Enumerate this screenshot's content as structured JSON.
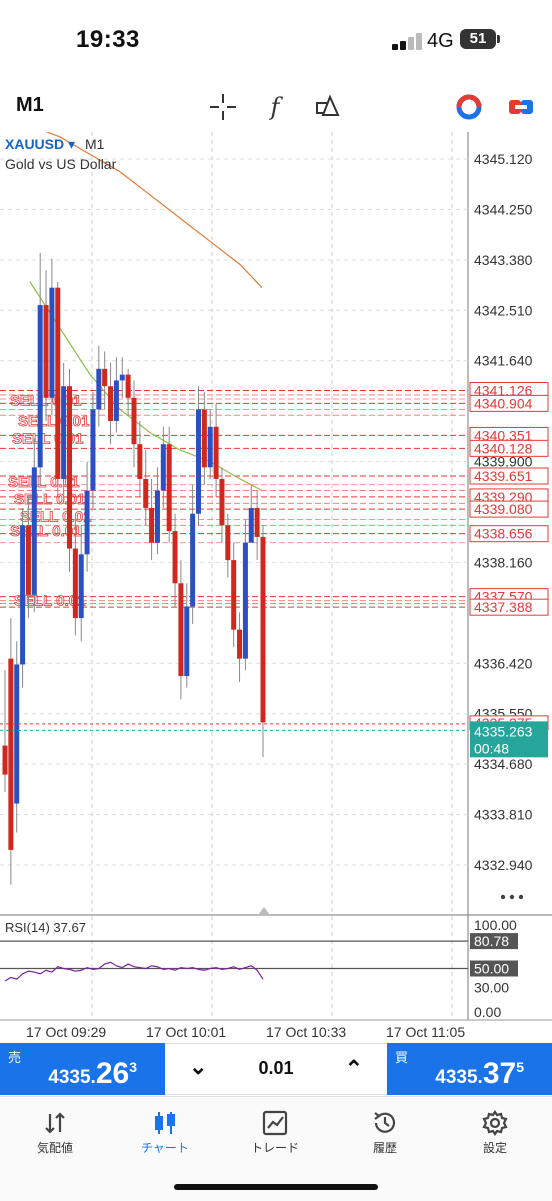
{
  "status_bar": {
    "time": "19:33",
    "network": "4G",
    "battery": "51"
  },
  "toolbar": {
    "timeframe": "M1",
    "icons": [
      "crosshair-icon",
      "function-icon",
      "objects-icon",
      "trade-settings-icon",
      "chart-switch-icon"
    ]
  },
  "chart": {
    "symbol": "XAUUSD",
    "symbol_arrow": "▾",
    "timeframe": "M1",
    "description": "Gold vs US Dollar",
    "price_scale": [
      "4345.120",
      "4344.250",
      "4343.380",
      "4342.510",
      "4341.640",
      "4339.900",
      "4338.160",
      "4336.420",
      "4335.550",
      "4334.680",
      "4333.810",
      "4332.940"
    ],
    "order_labels": [
      "4341.126",
      "4340.904",
      "4340.351",
      "4340.128",
      "4339.651",
      "4339.290",
      "4339.080",
      "4338.656",
      "4337.570",
      "4337.388"
    ],
    "ask_tag": "4335.375",
    "bid_tag": "4335.263",
    "countdown": "00:48",
    "sell_text": "SELL 0.01",
    "more_icon": "more-dots-icon",
    "time_labels": [
      "17 Oct 09:29",
      "17 Oct 10:01",
      "17 Oct 10:33",
      "17 Oct 11:05"
    ],
    "rsi": {
      "label": "RSI(14) 37.67",
      "levels": [
        "100.00",
        "80.78",
        "50.00",
        "30.00",
        "0.00"
      ]
    },
    "colors": {
      "bull": "#2c4fc4",
      "bear": "#d0281f",
      "ma_orange": "#e07b39",
      "ma_green": "#8bc34a",
      "rsi": "#7b1fa2",
      "bid": "#26a69a",
      "sell_lines": "#e53935"
    }
  },
  "chart_data": {
    "type": "candlestick",
    "symbol": "XAUUSD",
    "timeframe": "M1",
    "x": [
      "17 Oct 09:29",
      "17 Oct 10:01",
      "17 Oct 10:33",
      "17 Oct 11:05"
    ],
    "ylim": [
      4332.5,
      4345.5
    ],
    "close": [
      4334.5,
      4333.2,
      4336.4,
      4338.8,
      4337.6,
      4339.8,
      4342.6,
      4341.0,
      4342.9,
      4339.6,
      4341.2,
      4338.4,
      4337.2,
      4338.3,
      4339.4,
      4340.8,
      4341.5,
      4341.2,
      4340.6,
      4341.3,
      4341.4,
      4341.0,
      4340.2,
      4339.6,
      4339.1,
      4338.5,
      4339.4,
      4340.2,
      4338.7,
      4337.8,
      4336.2,
      4337.4,
      4339.0,
      4340.8,
      4339.8,
      4340.5,
      4339.6,
      4338.8,
      4338.2,
      4337.0,
      4336.5,
      4338.5,
      4339.1,
      4338.6,
      4335.4
    ],
    "open": [
      4335.0,
      4336.5,
      4334.0,
      4336.4,
      4338.8,
      4337.6,
      4339.8,
      4342.6,
      4341.0,
      4342.9,
      4339.6,
      4341.2,
      4338.4,
      4337.2,
      4338.3,
      4339.4,
      4340.8,
      4341.5,
      4341.2,
      4340.6,
      4341.3,
      4341.4,
      4341.0,
      4340.2,
      4339.6,
      4339.1,
      4338.5,
      4339.4,
      4340.2,
      4338.7,
      4337.8,
      4336.2,
      4337.4,
      4339.0,
      4340.8,
      4339.8,
      4340.5,
      4339.6,
      4338.8,
      4338.2,
      4337.0,
      4336.5,
      4338.5,
      4339.1,
      4338.6
    ],
    "high": [
      4336.3,
      4337.2,
      4336.8,
      4339.1,
      4339.3,
      4340.3,
      4343.5,
      4343.2,
      4343.4,
      4343.0,
      4341.6,
      4341.5,
      4338.9,
      4338.8,
      4339.9,
      4341.1,
      4341.9,
      4341.8,
      4341.6,
      4341.7,
      4341.7,
      4341.5,
      4341.3,
      4340.6,
      4340.1,
      4339.6,
      4339.8,
      4340.5,
      4340.5,
      4339.0,
      4338.2,
      4337.8,
      4339.5,
      4341.2,
      4341.1,
      4340.8,
      4340.9,
      4339.8,
      4339.0,
      4338.5,
      4337.3,
      4338.9,
      4339.5,
      4339.4,
      4338.8
    ],
    "low": [
      4334.2,
      4332.6,
      4333.5,
      4336.0,
      4337.2,
      4337.3,
      4339.5,
      4340.6,
      4340.7,
      4339.3,
      4339.2,
      4338.0,
      4336.9,
      4336.8,
      4338.0,
      4339.1,
      4340.5,
      4340.8,
      4340.2,
      4340.4,
      4341.0,
      4340.7,
      4339.8,
      4339.3,
      4338.8,
      4338.2,
      4338.3,
      4339.1,
      4338.5,
      4337.4,
      4335.8,
      4336.0,
      4337.1,
      4338.8,
      4339.5,
      4339.6,
      4339.3,
      4338.5,
      4337.9,
      4336.7,
      4336.1,
      4336.3,
      4338.7,
      4338.2,
      4334.8
    ],
    "moving_averages": [
      {
        "color": "orange",
        "values": [
          4345.7,
          4345.5,
          4345.2,
          4344.9,
          4344.5,
          4344.1,
          4343.7,
          4343.3,
          4342.9
        ]
      },
      {
        "color": "green",
        "values": [
          4343.0,
          4342.2,
          4341.4,
          4340.8,
          4340.4,
          4340.1,
          4339.9,
          4339.6,
          4339.4
        ]
      }
    ],
    "rsi": {
      "period": 14,
      "current": 37.67,
      "levels": [
        80.78,
        50.0
      ],
      "ylim": [
        0,
        100
      ],
      "values": [
        36,
        40,
        38,
        44,
        47,
        46,
        44,
        48,
        46,
        52,
        50,
        49,
        47,
        48,
        51,
        49,
        50,
        55,
        57,
        53,
        51,
        55,
        52,
        51,
        50,
        53,
        52,
        49,
        50,
        48,
        51,
        50,
        51,
        49,
        48,
        50,
        51,
        49,
        50,
        52,
        49,
        51,
        53,
        48,
        38
      ]
    },
    "sell_order_levels": [
      4341.126,
      4340.904,
      4340.351,
      4340.128,
      4339.651,
      4339.29,
      4339.08,
      4338.656,
      4337.57,
      4337.388
    ],
    "ask": 4335.375,
    "bid": 4335.263
  },
  "trade_bar": {
    "sell_label": "売",
    "sell_price_main": "4335.",
    "sell_price_big": "26",
    "sell_price_small": "3",
    "lot": "0.01",
    "buy_label": "買",
    "buy_price_main": "4335.",
    "buy_price_big": "37",
    "buy_price_small": "5"
  },
  "nav": {
    "items": [
      {
        "label": "気配値",
        "icon": "quotes-icon"
      },
      {
        "label": "チャート",
        "icon": "chart-icon"
      },
      {
        "label": "トレード",
        "icon": "trade-icon"
      },
      {
        "label": "履歴",
        "icon": "history-icon"
      },
      {
        "label": "設定",
        "icon": "settings-icon"
      }
    ]
  }
}
